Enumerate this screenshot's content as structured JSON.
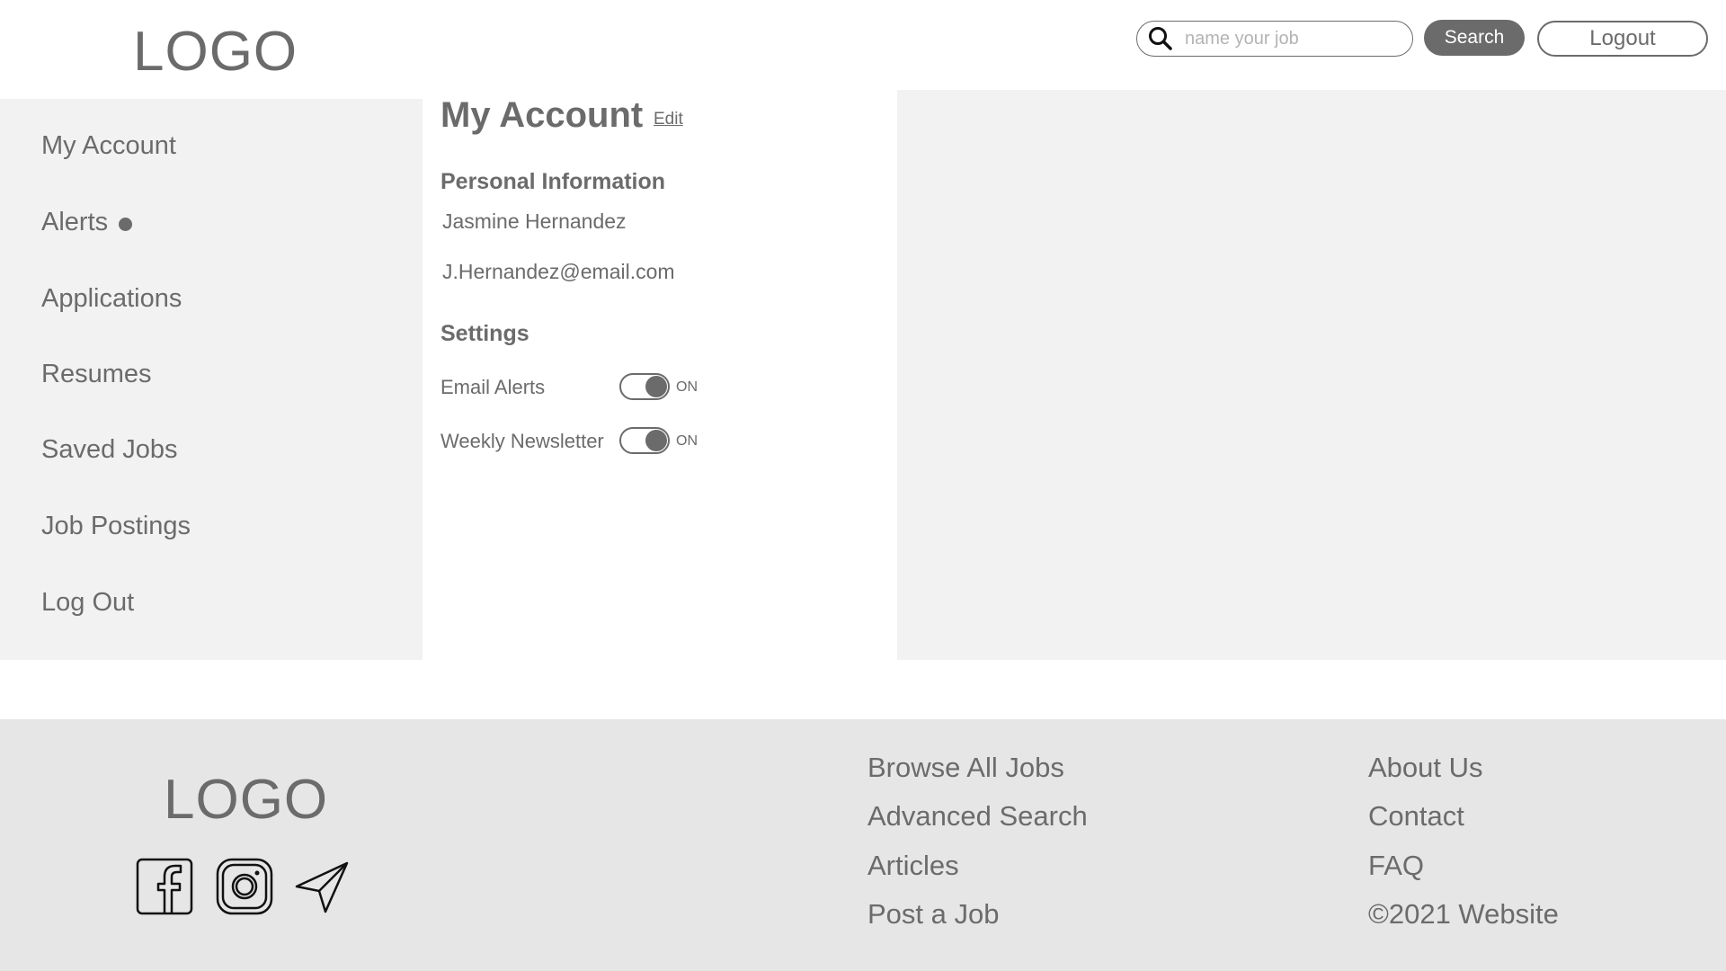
{
  "header": {
    "logo": "LOGO",
    "search_placeholder": "name your job",
    "search_label": "Search",
    "logout_label": "Logout"
  },
  "sidebar": {
    "items": [
      {
        "label": "My Account"
      },
      {
        "label": "Alerts",
        "has_indicator": true
      },
      {
        "label": "Applications"
      },
      {
        "label": "Resumes"
      },
      {
        "label": "Saved Jobs"
      },
      {
        "label": "Job Postings"
      },
      {
        "label": "Log Out"
      }
    ]
  },
  "main": {
    "title": "My Account",
    "edit_label": "Edit",
    "personal_heading": "Personal Information",
    "name": "Jasmine Hernandez",
    "email": "J.Hernandez@email.com",
    "settings_heading": "Settings",
    "settings": [
      {
        "label": "Email Alerts",
        "state": "ON"
      },
      {
        "label": "Weekly Newsletter",
        "state": "ON"
      }
    ]
  },
  "footer": {
    "logo": "LOGO",
    "social_icons": [
      "facebook-icon",
      "instagram-icon",
      "telegram-icon"
    ],
    "links_col1": [
      "Browse All Jobs",
      "Advanced Search",
      "Articles",
      "Post a Job"
    ],
    "links_col2": [
      "About Us",
      "Contact",
      "FAQ"
    ],
    "copyright": "©2021 Website"
  },
  "colors": {
    "primary_gray": "#6b6b6b",
    "panel_bg": "#f2f2f2",
    "footer_bg": "#e6e6e6",
    "placeholder": "#b3b3b3"
  }
}
